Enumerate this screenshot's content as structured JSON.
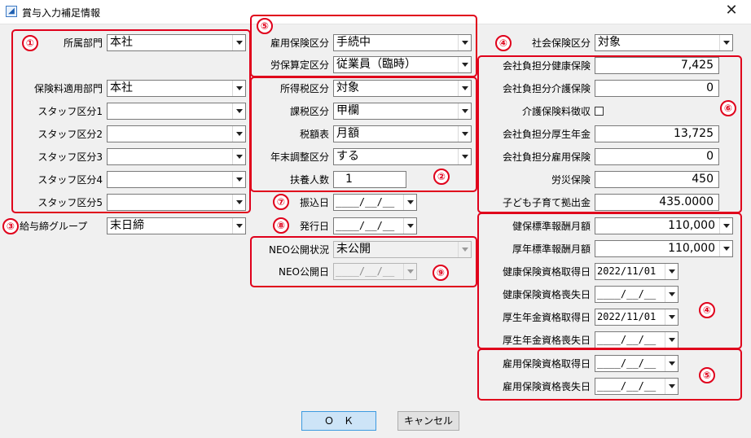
{
  "window": {
    "title": "賞与入力補足情報",
    "close": "✕",
    "app_icon": "◢"
  },
  "left": {
    "dept": {
      "label": "所属部門",
      "value": "本社"
    },
    "ins_dept": {
      "label": "保険料適用部門",
      "value": "本社"
    },
    "staff": [
      {
        "label": "スタッフ区分1",
        "value": ""
      },
      {
        "label": "スタッフ区分2",
        "value": ""
      },
      {
        "label": "スタッフ区分3",
        "value": ""
      },
      {
        "label": "スタッフ区分4",
        "value": ""
      },
      {
        "label": "スタッフ区分5",
        "value": ""
      }
    ],
    "payroll_group": {
      "label": "給与締グループ",
      "value": "末日締"
    }
  },
  "middle": {
    "employment_ins": {
      "label": "雇用保険区分",
      "value": "手続中"
    },
    "labor_ins": {
      "label": "労保算定区分",
      "value": "従業員（臨時）"
    },
    "income_tax": {
      "label": "所得税区分",
      "value": "対象"
    },
    "tax_class": {
      "label": "課税区分",
      "value": "甲欄"
    },
    "tax_table": {
      "label": "税額表",
      "value": "月額"
    },
    "year_end": {
      "label": "年末調整区分",
      "value": "する"
    },
    "dependents": {
      "label": "扶養人数",
      "value": "1"
    },
    "transfer_date": {
      "label": "振込日",
      "value": "____/__/__"
    },
    "issue_date": {
      "label": "発行日",
      "value": "____/__/__"
    },
    "neo_status": {
      "label": "NEO公開状況",
      "value": "未公開"
    },
    "neo_date": {
      "label": "NEO公開日",
      "value": "____/__/__"
    }
  },
  "right": {
    "social_ins": {
      "label": "社会保険区分",
      "value": "対象"
    },
    "co_health": {
      "label": "会社負担分健康保険",
      "value": "7,425"
    },
    "co_care": {
      "label": "会社負担分介護保険",
      "value": "0"
    },
    "care_collect": {
      "label": "介護保険料徴収",
      "checked": false
    },
    "co_pension": {
      "label": "会社負担分厚生年金",
      "value": "13,725"
    },
    "co_employment": {
      "label": "会社負担分雇用保険",
      "value": "0"
    },
    "workers_comp": {
      "label": "労災保険",
      "value": "450"
    },
    "child_support": {
      "label": "子ども子育て拠出金",
      "value": "435.0000"
    },
    "health_std": {
      "label": "健保標準報酬月額",
      "value": "110,000"
    },
    "pension_std": {
      "label": "厚年標準報酬月額",
      "value": "110,000"
    },
    "health_acq": {
      "label": "健康保険資格取得日",
      "value": "2022/11/01"
    },
    "health_loss": {
      "label": "健康保険資格喪失日",
      "value": "____/__/__"
    },
    "pension_acq": {
      "label": "厚生年金資格取得日",
      "value": "2022/11/01"
    },
    "pension_loss": {
      "label": "厚生年金資格喪失日",
      "value": "____/__/__"
    },
    "emp_acq": {
      "label": "雇用保険資格取得日",
      "value": "____/__/__"
    },
    "emp_loss": {
      "label": "雇用保険資格喪失日",
      "value": "____/__/__"
    }
  },
  "buttons": {
    "ok": "Ｏ　Ｋ",
    "cancel": "キャンセル"
  },
  "annotations": {
    "color": "#e0001b",
    "badges": [
      "①",
      "②",
      "③",
      "④",
      "⑤",
      "⑥",
      "⑦",
      "⑧",
      "⑨",
      "④",
      "⑤"
    ]
  }
}
